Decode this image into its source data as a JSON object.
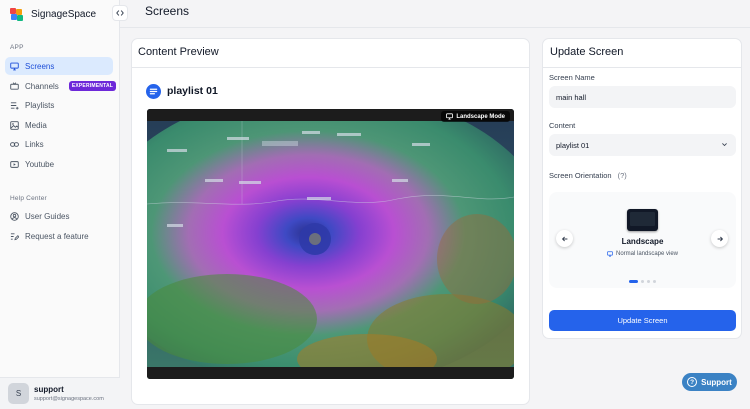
{
  "app": {
    "name": "SignageSpace"
  },
  "sidebar": {
    "section_app": "APP",
    "items": [
      {
        "label": "Screens",
        "icon": "monitor-icon",
        "active": true
      },
      {
        "label": "Channels",
        "icon": "broadcast-icon",
        "badge": "EXPERIMENTAL"
      },
      {
        "label": "Playlists",
        "icon": "list-icon"
      },
      {
        "label": "Media",
        "icon": "image-icon"
      },
      {
        "label": "Links",
        "icon": "link-icon"
      },
      {
        "label": "Youtube",
        "icon": "youtube-icon"
      }
    ],
    "section_help": "Help Center",
    "help_items": [
      {
        "label": "User Guides",
        "icon": "user-guide-icon"
      },
      {
        "label": "Request a feature",
        "icon": "edit-icon"
      }
    ],
    "user": {
      "initial": "S",
      "name": "support",
      "email": "support@signagespace.com"
    }
  },
  "header": {
    "title": "Screens",
    "collapse_icon": "code-brackets-icon"
  },
  "preview": {
    "title": "Content Preview",
    "playlist_name": "playlist 01",
    "mode_label": "Landscape Mode"
  },
  "update": {
    "title": "Update Screen",
    "screen_name_label": "Screen Name",
    "screen_name_value": "main hall",
    "content_label": "Content",
    "content_value": "playlist 01",
    "orientation_label": "Screen Orientation",
    "orientation_help": "(?)",
    "orientation_name": "Landscape",
    "orientation_desc": "Normal landscape view",
    "carousel_dots": 4,
    "carousel_active": 0,
    "submit_label": "Update Screen"
  },
  "support": {
    "label": "Support"
  },
  "colors": {
    "accent": "#2563eb",
    "badge": "#6d28d9",
    "support": "#3b82c4"
  }
}
